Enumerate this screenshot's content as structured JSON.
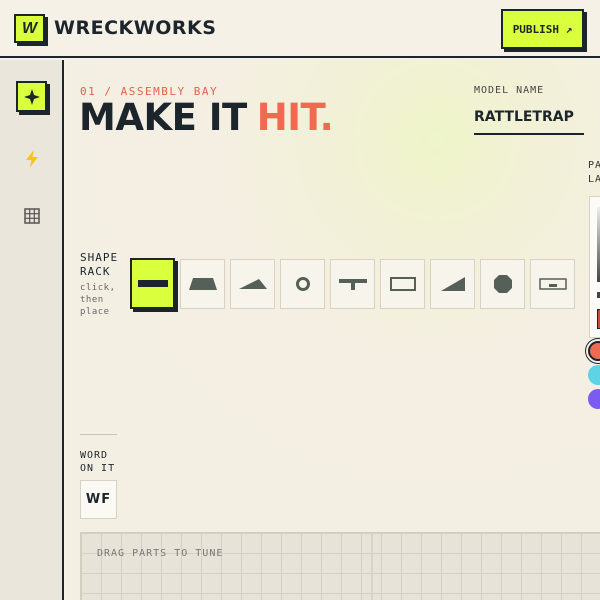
{
  "brand": {
    "mark": "W",
    "name": "WRECKWORKS"
  },
  "header": {
    "publish_label": "PUBLISH ↗"
  },
  "sidebar": {
    "items": [
      {
        "icon": "sparkle-icon",
        "active": true
      },
      {
        "icon": "bolt-icon",
        "active": false
      },
      {
        "icon": "grid-icon",
        "active": false
      }
    ]
  },
  "main": {
    "kicker": "01 / ASSEMBLY BAY",
    "headline_part1": "MAKE IT",
    "headline_part2": "HIT.",
    "model_label": "MODEL NAME",
    "model_value": "RATTLETRAP",
    "panel_label_line1": "PA",
    "panel_label_line2": "LA",
    "shape_rack": {
      "label_line1": "SHAPE",
      "label_line2": "RACK",
      "hint_line1": "click,",
      "hint_line2": "then",
      "hint_line3": "place",
      "shapes": [
        {
          "icon": "bar-shape-icon",
          "selected": true
        },
        {
          "icon": "trapezoid-shape-icon",
          "selected": false
        },
        {
          "icon": "wedge-shape-icon",
          "selected": false
        },
        {
          "icon": "ring-shape-icon",
          "selected": false
        },
        {
          "icon": "tee-shape-icon",
          "selected": false
        },
        {
          "icon": "frame-shape-icon",
          "selected": false
        },
        {
          "icon": "ramp-shape-icon",
          "selected": false
        },
        {
          "icon": "octagon-shape-icon",
          "selected": false
        },
        {
          "icon": "plate-shape-icon",
          "selected": false
        }
      ]
    },
    "swatches": [
      "#ef6a51",
      "#5fd3e6",
      "#7c5cf0"
    ],
    "word_label_line1": "WORD",
    "word_label_line2": "ON IT",
    "word_value": "WF",
    "canvas_hint": "DRAG PARTS TO TUNE"
  },
  "colors": {
    "accent": "#d9ff3d",
    "ink": "#1c252b",
    "coral": "#ef6a51",
    "paper": "#f6f1e7"
  }
}
